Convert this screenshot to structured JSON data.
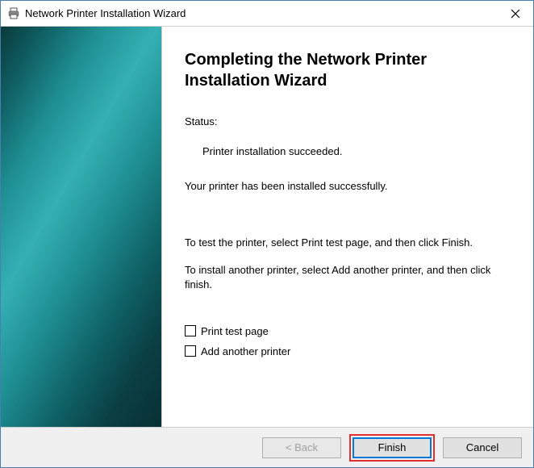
{
  "window": {
    "title": "Network Printer Installation Wizard"
  },
  "content": {
    "heading": "Completing the Network Printer Installation Wizard",
    "status_label": "Status:",
    "status_message": "Printer installation succeeded.",
    "success_text": "Your printer has been installed successfully.",
    "instruction_test": "To test the printer, select Print test page, and then click Finish.",
    "instruction_add": "To install another printer, select Add another printer, and then click finish.",
    "checkbox_print_test": "Print test page",
    "checkbox_add_another": "Add another printer"
  },
  "buttons": {
    "back": "< Back",
    "finish": "Finish",
    "cancel": "Cancel"
  }
}
